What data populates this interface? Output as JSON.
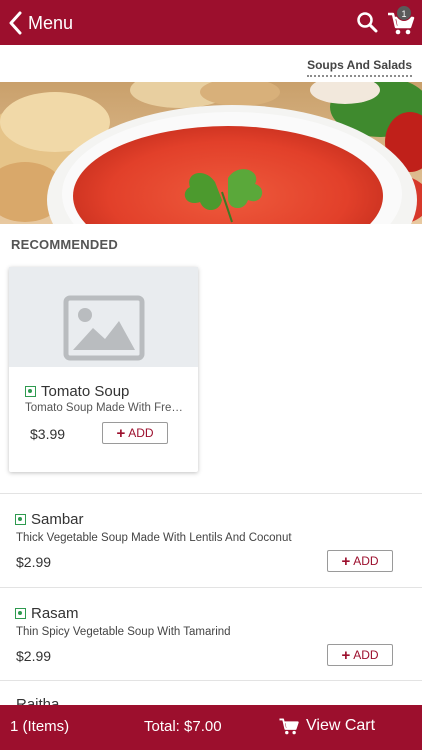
{
  "header": {
    "back_label": "Menu",
    "cart_count": "1"
  },
  "category": {
    "active_tab": "Soups And Salads"
  },
  "recommended": {
    "title": "RECOMMENDED",
    "items": [
      {
        "name": "Tomato Soup",
        "description": "Tomato Soup Made With Fresh Tomatoes",
        "price": "$3.99",
        "add_label": "ADD"
      }
    ]
  },
  "menu_items": [
    {
      "name": "Sambar",
      "description": "Thick Vegetable Soup Made With Lentils And Coconut",
      "price": "$2.99",
      "add_label": "ADD"
    },
    {
      "name": "Rasam",
      "description": "Thin Spicy Vegetable Soup With Tamarind",
      "price": "$2.99",
      "add_label": "ADD"
    },
    {
      "name": "Raitha"
    }
  ],
  "footer": {
    "items_count": "1 (Items)",
    "total": "Total: $7.00",
    "view_cart_label": "View Cart"
  },
  "colors": {
    "brand": "#9c0f2d",
    "veg_indicator": "#2e9a4f"
  },
  "icons": [
    "back-chevron-icon",
    "search-icon",
    "cart-icon",
    "image-placeholder-icon",
    "veg-icon",
    "plus-icon"
  ]
}
